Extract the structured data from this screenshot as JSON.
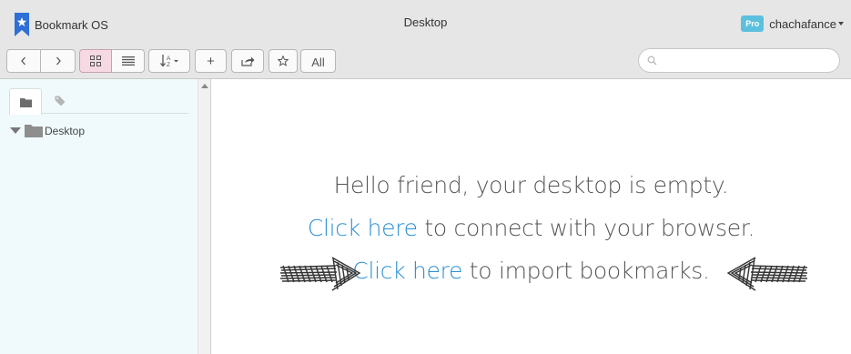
{
  "app": {
    "name": "Bookmark OS",
    "window_title": "Desktop"
  },
  "user": {
    "badge": "Pro",
    "name": "chachafance"
  },
  "toolbar": {
    "back_label": "‹",
    "forward_label": "›",
    "add_label": "+",
    "all_label": "All",
    "view_mode": "grid"
  },
  "search": {
    "placeholder": "",
    "value": ""
  },
  "sidebar": {
    "active_tab": "folders",
    "tree": [
      {
        "label": "Desktop",
        "expanded": true
      }
    ]
  },
  "main": {
    "line1": "Hello friend, your desktop is empty.",
    "link1": "Click here",
    "line2_rest": " to connect with your browser.",
    "link2": "Click here",
    "line3_rest": " to import bookmarks."
  },
  "colors": {
    "link": "#2a8fd4",
    "pro_badge": "#5bc0de",
    "active_button": "#f6d9e3",
    "sidebar_bg": "#f0fafd",
    "brand": "#2f6fd6"
  }
}
